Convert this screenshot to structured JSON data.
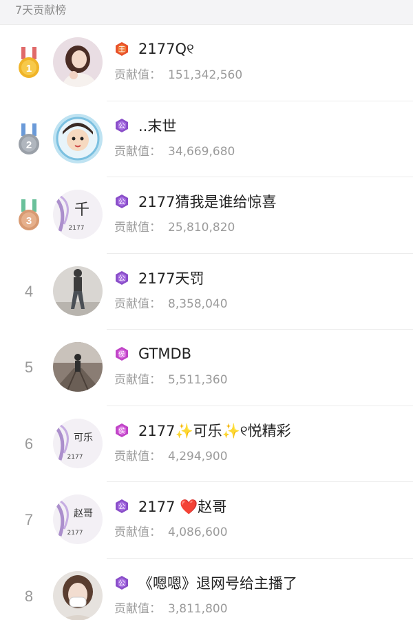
{
  "header": {
    "title": "7天贡献榜"
  },
  "colors": {
    "badge_king": "#e8502a",
    "badge_duke": "#8a4ec9",
    "badge_marquis": "#c044c7",
    "medal_gold": "#f0b428",
    "medal_silver": "#9aa0a8",
    "medal_bronze": "#d89a72"
  },
  "leaderboard": [
    {
      "rank": "1",
      "medal": "gold-medal-icon",
      "badge": "王",
      "badge_icon": "king-badge-icon",
      "name": "2177Q୧",
      "contrib_label": "贡献值：",
      "contrib_value": "151,342,560"
    },
    {
      "rank": "2",
      "medal": "silver-medal-icon",
      "badge": "公",
      "badge_icon": "duke-badge-icon",
      "name": "..末世",
      "contrib_label": "贡献值：",
      "contrib_value": "34,669,680"
    },
    {
      "rank": "3",
      "medal": "bronze-medal-icon",
      "badge": "公",
      "badge_icon": "duke-badge-icon",
      "name": "2177猜我是谁给惊喜",
      "contrib_label": "贡献值：",
      "contrib_value": "25,810,820"
    },
    {
      "rank": "4",
      "badge": "公",
      "badge_icon": "duke-badge-icon",
      "name": "2177天罚",
      "contrib_label": "贡献值：",
      "contrib_value": "8,358,040"
    },
    {
      "rank": "5",
      "badge": "侯",
      "badge_icon": "marquis-badge-icon",
      "name": "GTMDB",
      "contrib_label": "贡献值：",
      "contrib_value": "5,511,360"
    },
    {
      "rank": "6",
      "badge": "侯",
      "badge_icon": "marquis-badge-icon",
      "name": "2177✨可乐✨୧悦精彩",
      "contrib_label": "贡献值：",
      "contrib_value": "4,294,900"
    },
    {
      "rank": "7",
      "badge": "公",
      "badge_icon": "duke-badge-icon",
      "name": "2177 ❤️赵哥",
      "contrib_label": "贡献值：",
      "contrib_value": "4,086,600"
    },
    {
      "rank": "8",
      "badge": "公",
      "badge_icon": "duke-badge-icon",
      "name": "《嗯嗯》退网号给主播了",
      "contrib_label": "贡献值：",
      "contrib_value": "3,811,800"
    }
  ],
  "avatar_text": {
    "row3": {
      "big": "千",
      "small": "2177"
    },
    "row6": {
      "big": "可乐",
      "small": "2177"
    },
    "row7": {
      "big": "赵哥",
      "small": "2177"
    }
  }
}
